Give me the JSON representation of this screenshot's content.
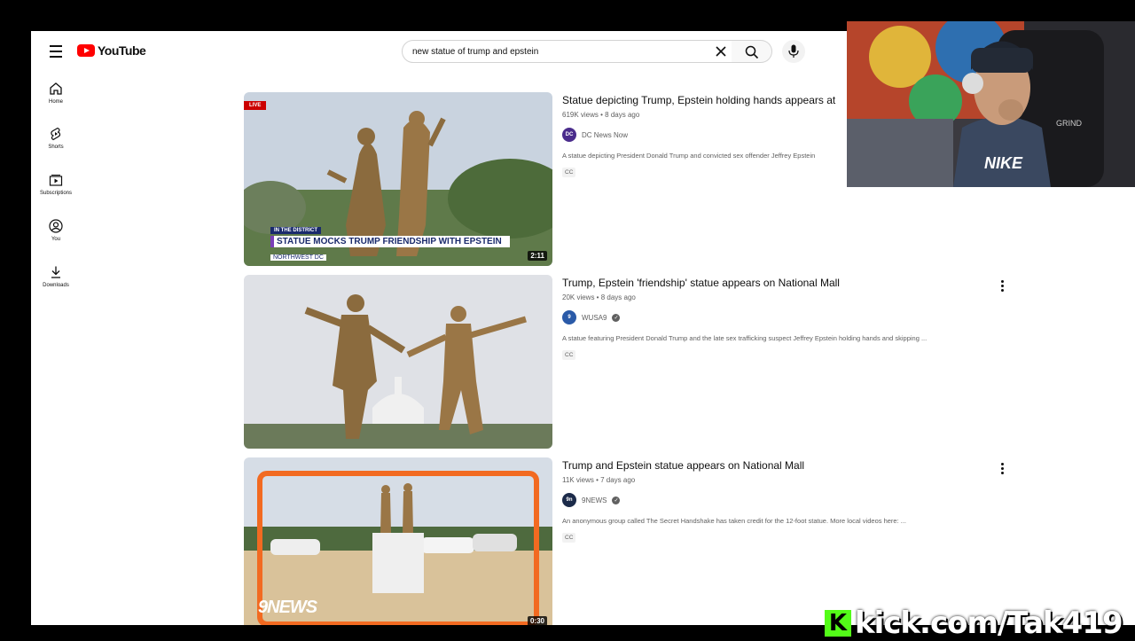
{
  "masthead": {
    "logo_text": "YouTube",
    "search_value": "new statue of trump and epstein"
  },
  "sidebar": {
    "items": [
      {
        "label": "Home",
        "icon": "home-icon"
      },
      {
        "label": "Shorts",
        "icon": "shorts-icon"
      },
      {
        "label": "Subscriptions",
        "icon": "subscriptions-icon"
      },
      {
        "label": "You",
        "icon": "you-icon"
      },
      {
        "label": "Downloads",
        "icon": "downloads-icon"
      }
    ]
  },
  "results": [
    {
      "title": "Statue depicting Trump, Epstein holding hands appears at",
      "meta": "619K views • 8 days ago",
      "channel": "DC News Now",
      "channel_avatar": "DC",
      "verified": false,
      "description": "A statue depicting President Donald Trump and convicted sex offender Jeffrey Epstein",
      "badge": "CC",
      "duration": "2:11",
      "live_label": "LIVE",
      "thumb_banner": {
        "tag": "IN THE DISTRICT",
        "headline": "STATUE MOCKS TRUMP FRIENDSHIP WITH EPSTEIN",
        "sub": "NORTHWEST DC"
      }
    },
    {
      "title": "Trump, Epstein 'friendship' statue appears on National Mall",
      "meta": "20K views • 8 days ago",
      "channel": "WUSA9",
      "channel_avatar": "9",
      "verified": true,
      "description": "A statue featuring President Donald Trump and the late sex trafficking suspect Jeffrey Epstein holding hands and skipping ...",
      "badge": "CC",
      "duration": ""
    },
    {
      "title": "Trump and Epstein statue appears on National Mall",
      "meta": "11K views • 7 days ago",
      "channel": "9NEWS",
      "channel_avatar": "9n",
      "verified": true,
      "description": "An anonymous group called The Secret Handshake has taken credit for the 12-foot statue. More local videos here: ...",
      "badge": "CC",
      "duration": "0:30",
      "thumb_logo": "9NEWS"
    }
  ],
  "webcam": {
    "shirt_text": "NIKE",
    "wall_text": "GRIND"
  },
  "stream_banner": {
    "logo": "K",
    "text": "kick.com/Tak419"
  },
  "colors": {
    "brand_red": "#ff0000",
    "kick_green": "#53fc18"
  }
}
